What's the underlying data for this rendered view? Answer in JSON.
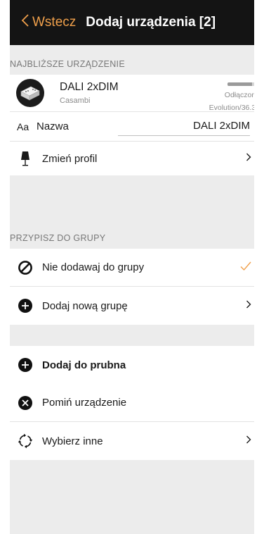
{
  "navbar": {
    "back_label": "Wstecz",
    "title": "Dodaj urządzenia [2]"
  },
  "nearest": {
    "section_title": "NAJBLIŻSZE URZĄDZENIE",
    "device_name": "DALI 2xDIM",
    "brand": "Casambi",
    "status": "Odłączono",
    "firmware": "Evolution/36.30",
    "signal_fraction": 0.75
  },
  "name_field": {
    "prefix": "Aa",
    "label": "Nazwa",
    "value": "DALI 2xDIM"
  },
  "profile": {
    "label": "Zmień profil"
  },
  "group": {
    "section_title": "PRZYPISZ DO GRUPY",
    "no_group_label": "Nie dodawaj do grupy",
    "new_group_label": "Dodaj nową grupę"
  },
  "actions": {
    "add_label": "Dodaj do prubna",
    "skip_label": "Pomiń urządzenie",
    "choose_label": "Wybierz inne"
  },
  "colors": {
    "accent": "#f0a04b",
    "navbar": "#141414",
    "background": "#ececec"
  }
}
